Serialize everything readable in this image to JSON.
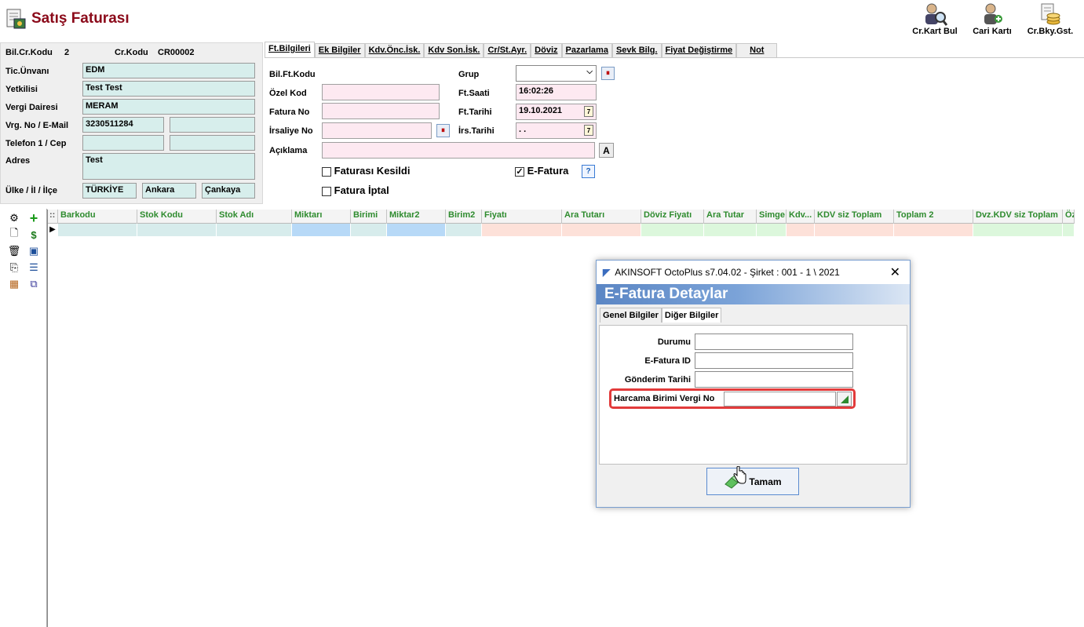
{
  "window": {
    "title": "Satış Faturası"
  },
  "toolbar": {
    "cr_kart_bul": "Cr.Kart Bul",
    "cari_karti": "Cari Kartı",
    "cr_bky_gst": "Cr.Bky.Gst."
  },
  "customer": {
    "bil_cr_kodu_label": "Bil.Cr.Kodu",
    "bil_cr_kodu_value": "2",
    "cr_kodu_label": "Cr.Kodu",
    "cr_kodu_value": "CR00002",
    "tic_unvani_label": "Tic.Ünvanı",
    "tic_unvani_value": "EDM",
    "yetkilisi_label": "Yetkilisi",
    "yetkilisi_value": "Test Test",
    "vergi_dairesi_label": "Vergi Dairesi",
    "vergi_dairesi_value": "MERAM",
    "vrg_no_label": "Vrg. No / E-Mail",
    "vrg_no_value": "3230511284",
    "email_value": "",
    "telefon_label": "Telefon 1 / Cep",
    "telefon_value": "",
    "cep_value": "",
    "adres_label": "Adres",
    "adres_value": "Test",
    "ulke_label": "Ülke / İl / İlçe",
    "ulke_value": "TÜRKİYE",
    "il_value": "Ankara",
    "ilce_value": "Çankaya"
  },
  "tabs": [
    "Ft.Bilgileri",
    "Ek Bilgiler",
    "Kdv.Önc.İsk.",
    "Kdv Son.İsk.",
    "Cr/St.Ayr.",
    "Döviz",
    "Pazarlama",
    "Sevk Bilg.",
    "Fiyat Değiştirme",
    "Not"
  ],
  "invoice": {
    "bil_ft_kodu_label": "Bil.Ft.Kodu",
    "ozel_kod_label": "Özel Kod",
    "fatura_no_label": "Fatura No",
    "irsaliye_no_label": "İrsaliye No",
    "aciklama_label": "Açıklama",
    "grup_label": "Grup",
    "ft_saati_label": "Ft.Saati",
    "ft_saati_value": "16:02:26",
    "ft_tarihi_label": "Ft.Tarihi",
    "ft_tarihi_value": "19.10.2021",
    "irs_tarihi_label": "İrs.Tarihi",
    "irs_tarihi_value": " . .",
    "faturasi_kesildi_label": "Faturası Kesildi",
    "fatura_iptal_label": "Fatura İptal",
    "e_fatura_label": "E-Fatura",
    "e_fatura_checked": true,
    "aciklama_button": "A",
    "help_button": "?"
  },
  "grid": {
    "columns": [
      "Barkodu",
      "Stok Kodu",
      "Stok Adı",
      "Miktarı",
      "Birimi",
      "Miktar2",
      "Birim2",
      "Fiyatı",
      "Ara Tutarı",
      "Döviz Fiyatı",
      "Ara Tutar",
      "Simge",
      "Kdv...",
      "KDV siz Toplam",
      "Toplam 2",
      "Dvz.KDV siz Toplam",
      "Öz"
    ],
    "row_colors": [
      "#d7ecec",
      "#d7ecec",
      "#d7ecec",
      "#b7d9f7",
      "#d7ecec",
      "#b7d9f7",
      "#d7ecec",
      "#fde1d9",
      "#fde1d9",
      "#dcf7dc",
      "#dcf7dc",
      "#dcf7dc",
      "#fde1d9",
      "#fde1d9",
      "#fde1d9",
      "#dcf7dc",
      "#dcf7dc"
    ]
  },
  "dialog": {
    "title": "AKINSOFT OctoPlus s7.04.02  -  Şirket : 001 - 1 \\ 2021",
    "header": "E-Fatura Detaylar",
    "tabs": [
      "Genel Bilgiler",
      "Diğer Bilgiler"
    ],
    "durumu_label": "Durumu",
    "efatura_id_label": "E-Fatura ID",
    "gonderim_tarihi_label": "Gönderim Tarihi",
    "harcama_label": "Harcama Birimi Vergi No",
    "ok_button": "Tamam",
    "highlight_color": "#e23b3b"
  }
}
